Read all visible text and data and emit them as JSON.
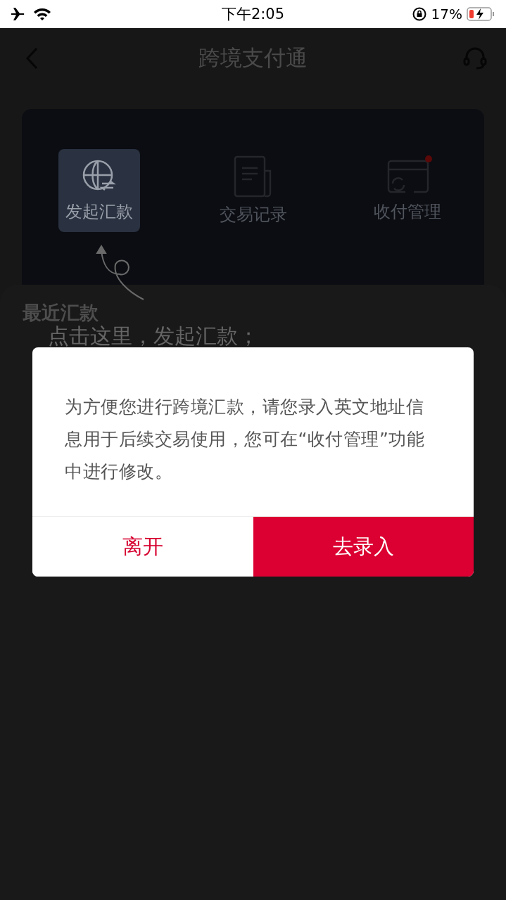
{
  "status_bar": {
    "time": "下午2:05",
    "battery": "17%"
  },
  "nav": {
    "title": "跨境支付通"
  },
  "features": [
    {
      "label": "发起汇款",
      "selected": true,
      "badge": false,
      "kind": "globe"
    },
    {
      "label": "交易记录",
      "selected": false,
      "badge": false,
      "kind": "document"
    },
    {
      "label": "收付管理",
      "selected": false,
      "badge": true,
      "kind": "card"
    }
  ],
  "section_title": "最近汇款",
  "coach_mark": {
    "text": "点击这里，发起汇款；"
  },
  "dialog": {
    "message": "为方便您进行跨境汇款，请您录入英文地址信息用于后续交易使用，您可在“收付管理”功能中进行修改。",
    "buttons": [
      {
        "label": "离开",
        "kind": "secondary"
      },
      {
        "label": "去录入",
        "kind": "primary"
      }
    ]
  }
}
